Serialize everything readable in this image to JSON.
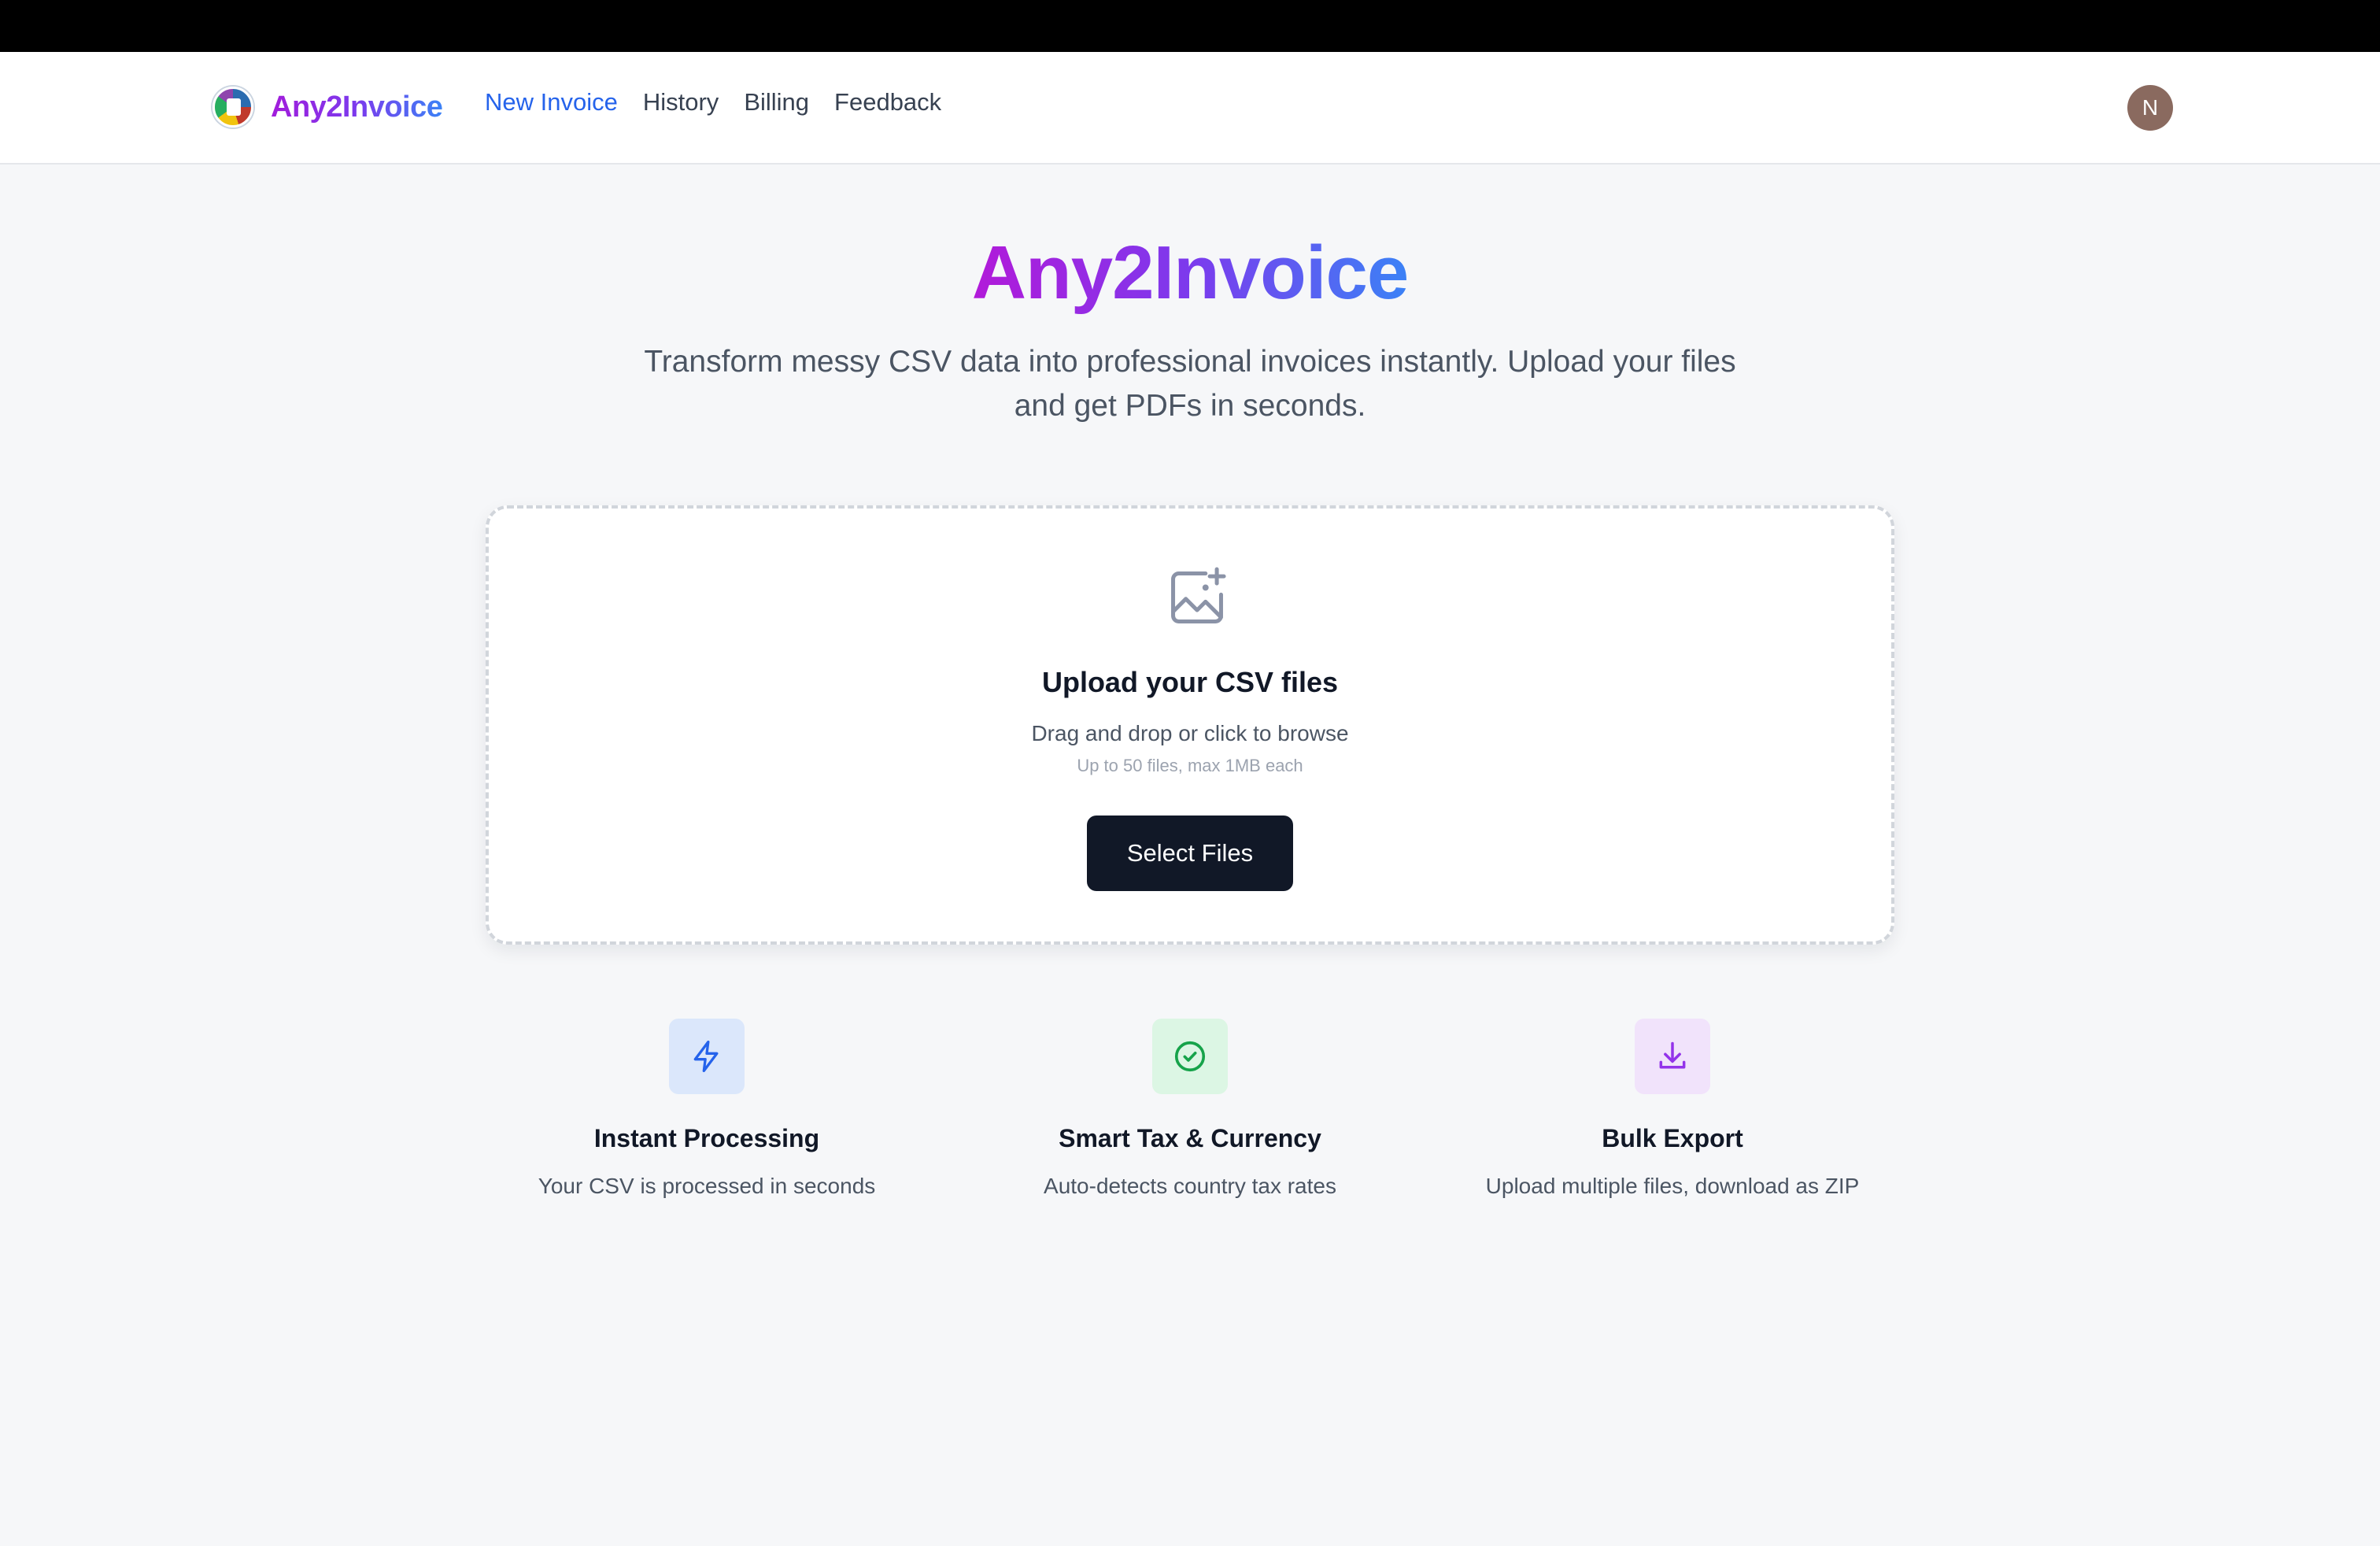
{
  "window": {
    "title": "Any2Invoice"
  },
  "header": {
    "brand": "Any2Invoice",
    "nav": [
      {
        "label": "New Invoice",
        "active": true
      },
      {
        "label": "History",
        "active": false
      },
      {
        "label": "Billing",
        "active": false
      },
      {
        "label": "Feedback",
        "active": false
      }
    ],
    "avatar_initial": "N"
  },
  "hero": {
    "title": "Any2Invoice",
    "subtitle": "Transform messy CSV data into professional invoices instantly. Upload your files and get PDFs in seconds."
  },
  "upload": {
    "icon": "image-plus-icon",
    "title": "Upload your CSV files",
    "description": "Drag and drop or click to browse",
    "limit": "Up to 50 files, max 1MB each",
    "button_label": "Select Files"
  },
  "features": [
    {
      "icon": "lightning-icon",
      "title": "Instant Processing",
      "description": "Your CSV is processed in seconds",
      "accent": "#2563eb",
      "bg": "#dbe7fb"
    },
    {
      "icon": "check-circle-icon",
      "title": "Smart Tax & Currency",
      "description": "Auto-detects country tax rates",
      "accent": "#16a34a",
      "bg": "#dcf6e4"
    },
    {
      "icon": "download-icon",
      "title": "Bulk Export",
      "description": "Upload multiple files, download as ZIP",
      "accent": "#9333ea",
      "bg": "#f1e3fb"
    }
  ],
  "colors": {
    "brand_gradient_start": "#a21cdb",
    "brand_gradient_end": "#3b82f6",
    "nav_active": "#2563eb",
    "button_bg": "#111827"
  }
}
